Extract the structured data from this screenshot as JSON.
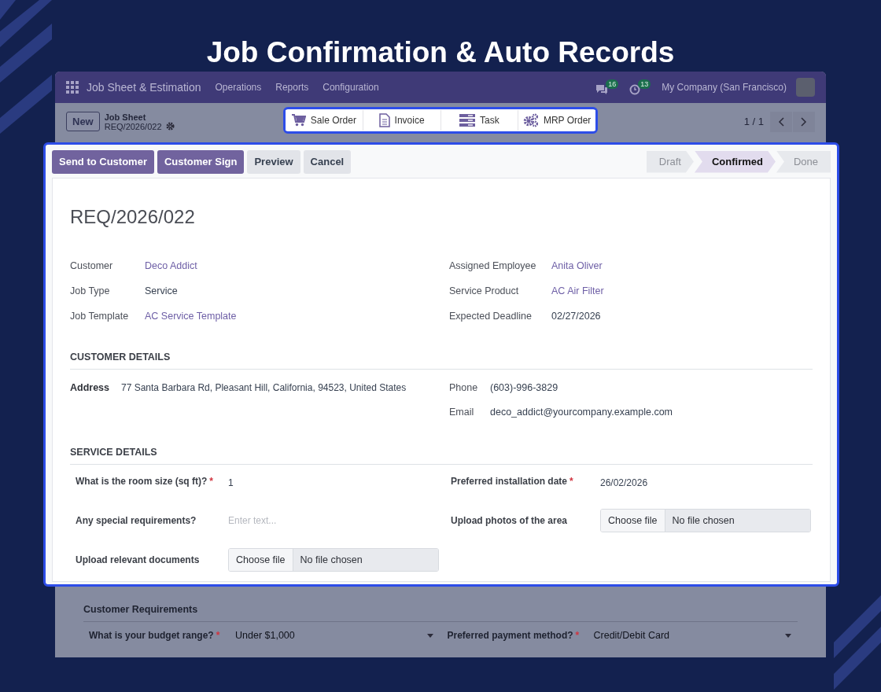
{
  "title": "Job Confirmation & Auto Records",
  "app": {
    "nav": {
      "app_name": "Job Sheet & Estimation",
      "menus": [
        "Operations",
        "Reports",
        "Configuration"
      ],
      "message_count": "16",
      "activity_count": "13",
      "company": "My Company (San Francisco)"
    },
    "control": {
      "new_button": "New",
      "breadcrumb": "Job Sheet",
      "record": "REQ/2026/022",
      "pager": "1 / 1",
      "smart_buttons": [
        {
          "label": "Sale Order"
        },
        {
          "label": "Invoice"
        },
        {
          "label": "Task"
        },
        {
          "label": "MRP Order"
        }
      ]
    }
  },
  "form": {
    "actions": [
      {
        "label": "Send to Customer",
        "kind": "primary"
      },
      {
        "label": "Customer Sign",
        "kind": "primary"
      },
      {
        "label": "Preview",
        "kind": "secondary"
      },
      {
        "label": "Cancel",
        "kind": "secondary"
      }
    ],
    "stages": [
      {
        "label": "Draft",
        "selected": false
      },
      {
        "label": "Confirmed",
        "selected": true
      },
      {
        "label": "Done",
        "selected": false
      }
    ],
    "record_title": "REQ/2026/022",
    "left_fields": [
      {
        "label": "Customer",
        "value": "Deco Addict",
        "link": true
      },
      {
        "label": "Job Type",
        "value": "Service",
        "link": false
      },
      {
        "label": "Job Template",
        "value": "AC Service Template",
        "link": true
      }
    ],
    "right_fields": [
      {
        "label": "Assigned Employee",
        "value": "Anita Oliver",
        "link": true
      },
      {
        "label": "Service Product",
        "value": "AC Air Filter",
        "link": true
      },
      {
        "label": "Expected Deadline",
        "value": "02/27/2026",
        "link": false
      }
    ],
    "customer_details": {
      "heading": "CUSTOMER DETAILS",
      "address_label": "Address",
      "address": "77 Santa Barbara Rd, Pleasant Hill, California, 94523, United States",
      "contacts": [
        {
          "label": "Phone",
          "value": "(603)-996-3829"
        },
        {
          "label": "Email",
          "value": "deco_addict@yourcompany.example.com"
        }
      ]
    },
    "service_details": {
      "heading": "SERVICE DETAILS",
      "questions": [
        {
          "label": "What is the room size (sq ft)?",
          "required_mark": "*",
          "kind": "text",
          "value": "1"
        },
        {
          "label": "Preferred installation date",
          "required_mark": "*",
          "kind": "text",
          "value": "26/02/2026"
        },
        {
          "label": "Any special requirements?",
          "kind": "empty",
          "placeholder": "Enter text..."
        },
        {
          "label": "Upload photos of the area",
          "kind": "file",
          "button": "Choose file",
          "value": "No file chosen"
        },
        {
          "label": "Upload relevant documents",
          "kind": "file",
          "button": "Choose file",
          "value": "No file chosen"
        }
      ]
    }
  },
  "requirements": {
    "heading": "Customer Requirements",
    "questions": [
      {
        "label": "What is your budget range?",
        "required_mark": "*",
        "value": "Under $1,000"
      },
      {
        "label": "Preferred payment method?",
        "required_mark": "*",
        "value": "Credit/Debit Card"
      }
    ]
  }
}
